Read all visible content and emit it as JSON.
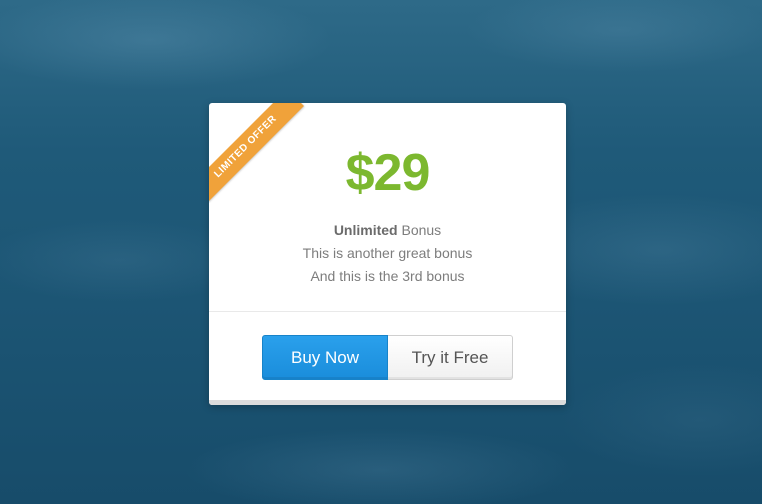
{
  "ribbon": {
    "label": "LIMITED OFFER"
  },
  "pricing": {
    "price": "$29",
    "features": {
      "line1_bold": "Unlimited",
      "line1_rest": " Bonus",
      "line2": "This is another great bonus",
      "line3": "And this is the 3rd bonus"
    }
  },
  "actions": {
    "buy_label": "Buy Now",
    "try_label": "Try it Free"
  },
  "colors": {
    "price": "#7cb82f",
    "ribbon": "#f0a23a",
    "primary_button": "#1a8ddb",
    "background": "#1f5a79"
  }
}
